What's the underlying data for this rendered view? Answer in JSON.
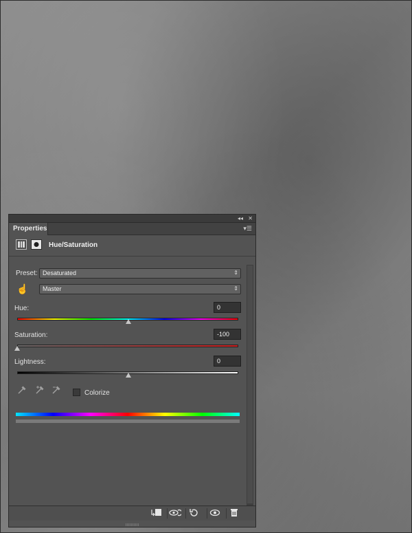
{
  "panel": {
    "tab_label": "Properties",
    "collapse_icon": "double-chevron-icon",
    "close_icon": "close-icon",
    "menu_icon": "panel-menu-icon",
    "title": "Hue/Saturation",
    "preset_label": "Preset:",
    "preset_value": "Desaturated",
    "channel_value": "Master",
    "hue_label": "Hue:",
    "hue_value": "0",
    "saturation_label": "Saturation:",
    "saturation_value": "-100",
    "lightness_label": "Lightness:",
    "lightness_value": "0",
    "colorize_label": "Colorize"
  },
  "footer": {
    "buttons": [
      "clip-to-layer-icon",
      "view-previous-icon",
      "reset-icon",
      "visibility-icon",
      "delete-icon"
    ]
  },
  "colors": {
    "panel_bg": "#535353",
    "field_bg": "#333333",
    "select_bg": "#616161"
  }
}
